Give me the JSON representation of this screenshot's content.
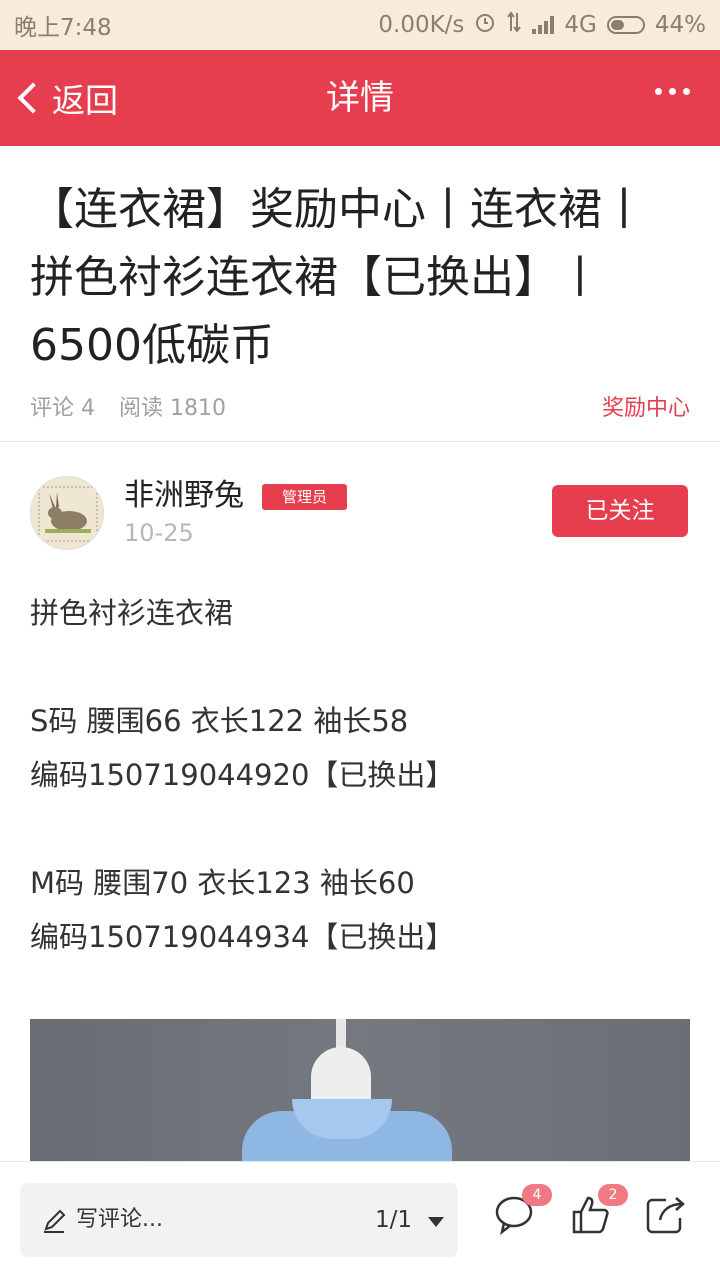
{
  "status_bar": {
    "time": "晚上7:48",
    "network_speed": "0.00K/s",
    "network_type": "4G",
    "battery": "44%",
    "battery_level": 0.44
  },
  "nav": {
    "back_label": "返回",
    "title": "详情",
    "more_icon": "more-icon"
  },
  "article": {
    "title": "【连衣裙】奖励中心丨连衣裙丨拼色衬衫连衣裙【已换出】丨6500低碳币",
    "comments_label": "评论 4",
    "reads_label": "阅读 1810",
    "category": "奖励中心"
  },
  "author": {
    "name": "非洲野兔",
    "badge": "管理员",
    "date": "10-25",
    "follow_label": "已关注"
  },
  "content": {
    "lines": [
      "拼色衬衫连衣裙",
      "",
      "S码  腰围66  衣长122  袖长58",
      "编码150719044920【已换出】",
      "",
      "M码  腰围70  衣长123  袖长60",
      "编码150719044934【已换出】"
    ]
  },
  "bottom_bar": {
    "comment_placeholder": "写评论...",
    "page_indicator": "1/1",
    "comment_count": "4",
    "like_count": "2"
  },
  "colors": {
    "accent": "#e63d4f",
    "status_bar_bg": "#f6ecd9"
  }
}
